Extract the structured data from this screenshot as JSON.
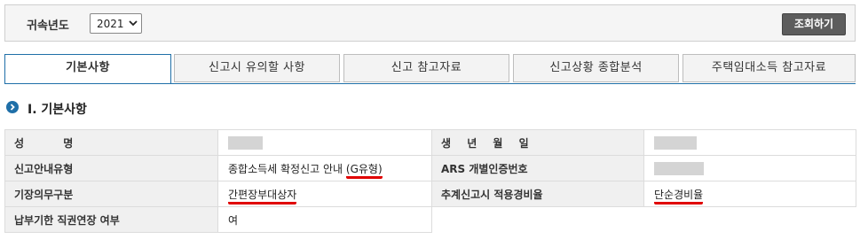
{
  "search": {
    "year_label": "귀속년도",
    "year_value": "2021",
    "query_button": "조회하기"
  },
  "tabs": [
    {
      "label": "기본사항",
      "active": true
    },
    {
      "label": "신고시 유의할 사항",
      "active": false
    },
    {
      "label": "신고 참고자료",
      "active": false
    },
    {
      "label": "신고상황 종합분석",
      "active": false
    },
    {
      "label": "주택임대소득 참고자료",
      "active": false
    }
  ],
  "section": {
    "title": "Ⅰ. 기본사항"
  },
  "table": {
    "r1": {
      "l1": "성 명",
      "l2": "생 년 월 일"
    },
    "r2": {
      "l1": "신고안내유형",
      "v1a": "종합소득세 확정신고 안내 ",
      "v1b": "(G유형)",
      "l2": "ARS 개별인증번호"
    },
    "r3": {
      "l1": "기장의무구분",
      "v1": "간편장부대상자",
      "l2": "추계신고시 적용경비율",
      "v2": "단순경비율"
    },
    "r4": {
      "l1": "납부기한 직권연장 여부",
      "v1": "여"
    }
  },
  "colors": {
    "accent": "#1f6fa8",
    "underline": "#e00000",
    "button": "#5d5d5d"
  }
}
